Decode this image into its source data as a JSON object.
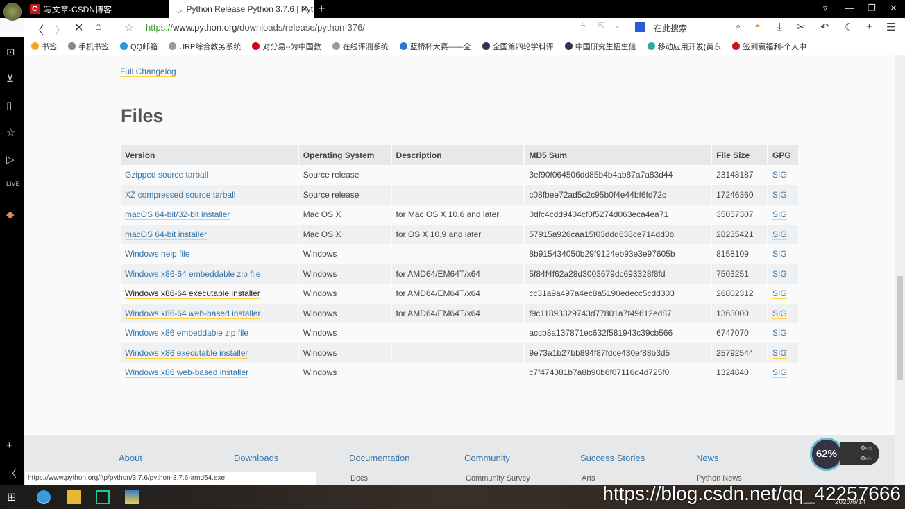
{
  "tabs": [
    {
      "label": "写文章-CSDN博客",
      "active": false
    },
    {
      "label": "Python Release Python 3.7.6 | Pyt",
      "active": true
    }
  ],
  "address": {
    "scheme": "https://",
    "host": "www.python.org",
    "path": "/downloads/release/python-376/"
  },
  "search_placeholder": "在此搜索",
  "bookmarks": [
    "书签",
    "手机书签",
    "QQ邮箱",
    "URP综合教务系统",
    "对分易--为中国教",
    "在线评测系统",
    "蓝桥杯大赛——全",
    "全国第四轮学科评",
    "中国研究生招生信",
    "移动应用开发(黄东",
    "签到赢福利-个人中"
  ],
  "page": {
    "changelog": "Full Changelog",
    "files_title": "Files",
    "columns": [
      "Version",
      "Operating System",
      "Description",
      "MD5 Sum",
      "File Size",
      "GPG"
    ],
    "rows": [
      [
        "Gzipped source tarball",
        "Source release",
        "",
        "3ef90f064506dd85b4b4ab87a7a83d44",
        "23148187",
        "SIG"
      ],
      [
        "XZ compressed source tarball",
        "Source release",
        "",
        "c08fbee72ad5c2c95b0f4e44bf6fd72c",
        "17246360",
        "SIG"
      ],
      [
        "macOS 64-bit/32-bit installer",
        "Mac OS X",
        "for Mac OS X 10.6 and later",
        "0dfc4cdd9404cf0f5274d063eca4ea71",
        "35057307",
        "SIG"
      ],
      [
        "macOS 64-bit installer",
        "Mac OS X",
        "for OS X 10.9 and later",
        "57915a926caa15f03ddd638ce714dd3b",
        "28235421",
        "SIG"
      ],
      [
        "Windows help file",
        "Windows",
        "",
        "8b915434050b29f9124eb93e3e97605b",
        "8158109",
        "SIG"
      ],
      [
        "Windows x86-64 embeddable zip file",
        "Windows",
        "for AMD64/EM64T/x64",
        "5f84f4f62a28d3003679dc693328f8fd",
        "7503251",
        "SIG"
      ],
      [
        "Windows x86-64 executable installer",
        "Windows",
        "for AMD64/EM64T/x64",
        "cc31a9a497a4ec8a5190edecc5cdd303",
        "26802312",
        "SIG"
      ],
      [
        "Windows x86-64 web-based installer",
        "Windows",
        "for AMD64/EM64T/x64",
        "f9c11893329743d77801a7f49612ed87",
        "1363000",
        "SIG"
      ],
      [
        "Windows x86 embeddable zip file",
        "Windows",
        "",
        "accb8a137871ec632f581943c39cb566",
        "6747070",
        "SIG"
      ],
      [
        "Windows x86 executable installer",
        "Windows",
        "",
        "9e73a1b27bb894f87fdce430ef88b3d5",
        "25792544",
        "SIG"
      ],
      [
        "Windows x86 web-based installer",
        "Windows",
        "",
        "c7f474381b7a8b90b6f07116d4d725f0",
        "1324840",
        "SIG"
      ]
    ],
    "hovered_row": 6
  },
  "footer": {
    "headings": [
      "About",
      "Downloads",
      "Documentation",
      "Community",
      "Success Stories",
      "News"
    ],
    "subs": [
      "Docs",
      "Community Survey",
      "Arts",
      "Python News"
    ]
  },
  "status_url": "https://www.python.org/ftp/python/3.7.6/python-3.7.6-amd64.exe",
  "speed_widget": {
    "percent": "62%",
    "up": "0",
    "down": "0",
    "unit": "K/s"
  },
  "watermark": "https://blog.csdn.net/qq_42257666",
  "date": "2020/6/14"
}
